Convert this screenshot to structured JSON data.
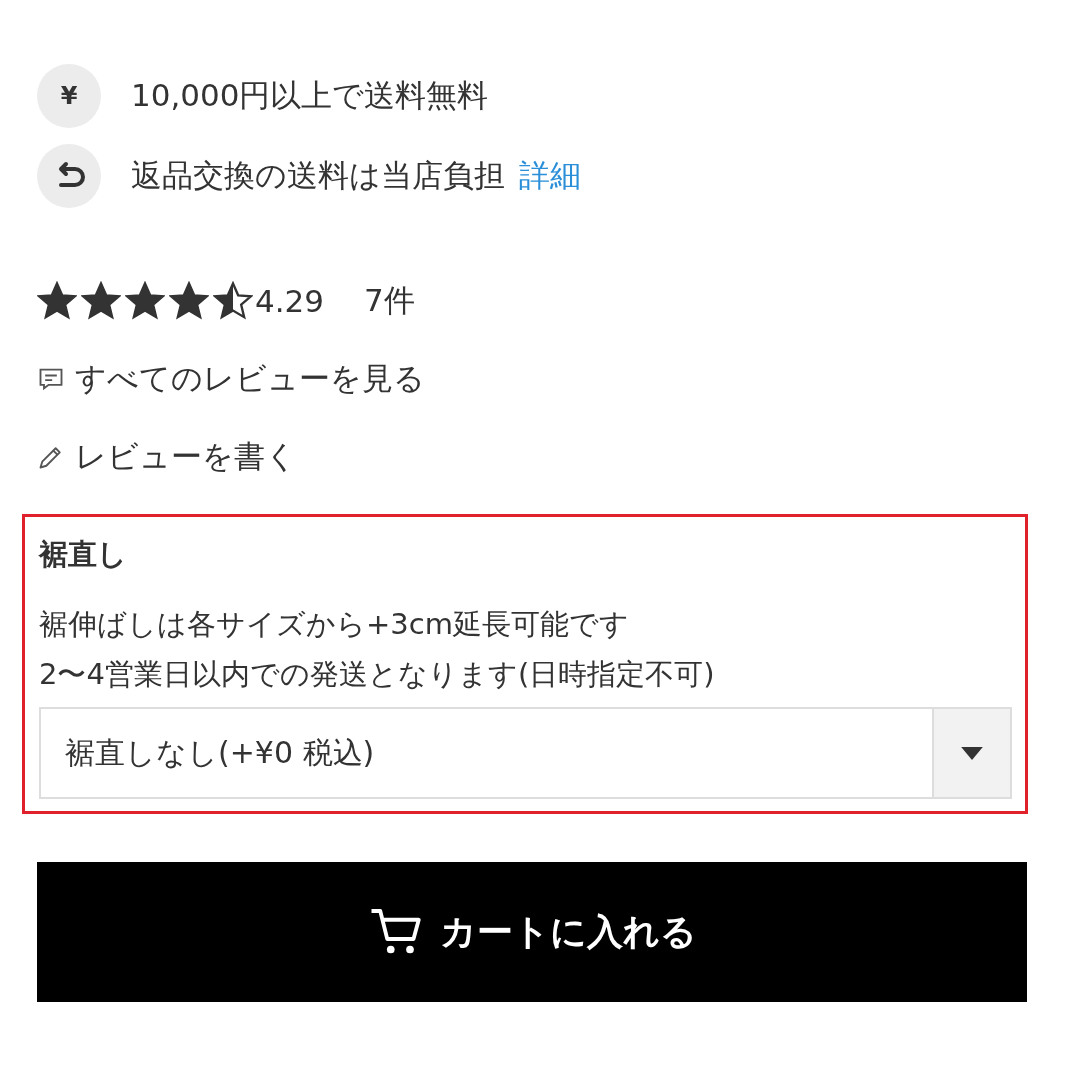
{
  "perks": [
    {
      "kind": "yen",
      "icon_text": "¥",
      "text": "10,000円以上で送料無料"
    },
    {
      "kind": "return",
      "text": "返品交換の送料は当店負担",
      "link": "詳細"
    }
  ],
  "rating": {
    "stars": 4.5,
    "score": "4.29",
    "count": "7件"
  },
  "review_links": [
    {
      "kind": "comment",
      "text": "すべてのレビューを見る"
    },
    {
      "kind": "pencil",
      "text": "レビューを書く"
    }
  ],
  "option": {
    "highlighted": true,
    "title": "裾直し",
    "notes": [
      "裾伸ばしは各サイズから+3cm延長可能です",
      "2〜4営業日以内での発送となります(日時指定不可)"
    ],
    "select_value": "裾直しなし(+¥0 税込)"
  },
  "cart_button": "カートに入れる"
}
